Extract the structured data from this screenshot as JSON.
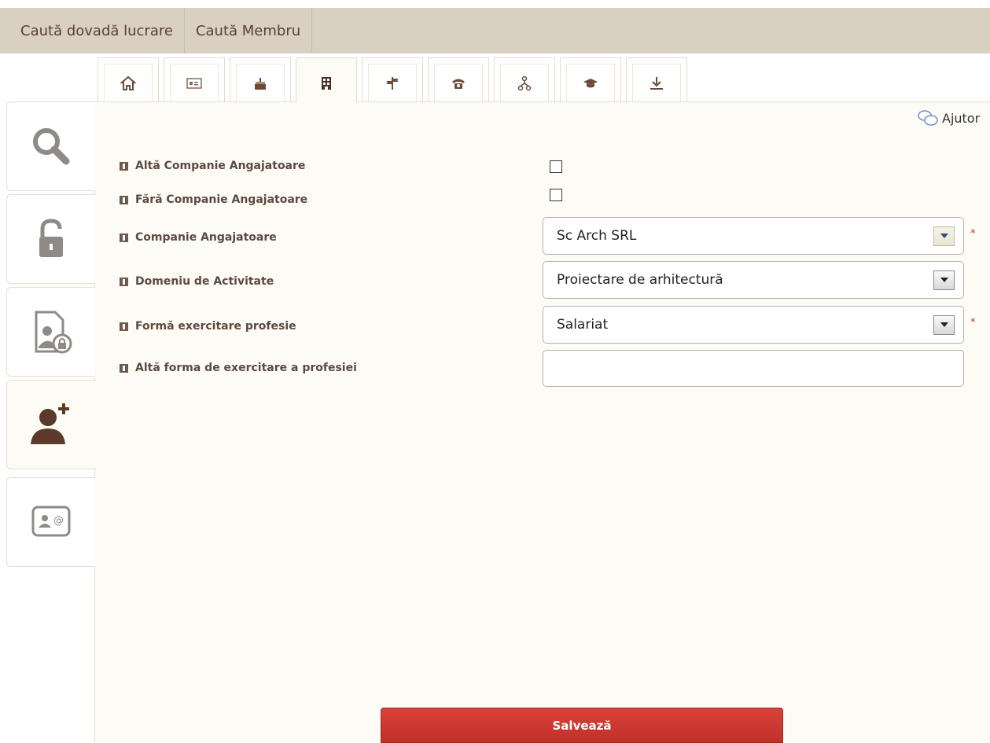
{
  "topnav": {
    "items": [
      {
        "label": "Caută dovadă lucrare"
      },
      {
        "label": "Caută Membru"
      }
    ]
  },
  "icon_tabs": [
    {
      "icon": "home-icon"
    },
    {
      "icon": "id-card-icon"
    },
    {
      "icon": "birthday-cake-icon"
    },
    {
      "icon": "building-icon",
      "active": true
    },
    {
      "icon": "signpost-icon"
    },
    {
      "icon": "phone-icon"
    },
    {
      "icon": "hierarchy-icon"
    },
    {
      "icon": "graduation-cap-icon"
    },
    {
      "icon": "download-icon"
    }
  ],
  "sidebar": [
    {
      "icon": "search-icon"
    },
    {
      "icon": "lock-icon"
    },
    {
      "icon": "secure-document-icon"
    },
    {
      "icon": "add-user-icon",
      "active": true
    },
    {
      "icon": "contact-card-icon"
    }
  ],
  "help": {
    "label": "Ajutor"
  },
  "form": {
    "alta_companie_label": "Altă Companie Angajatoare",
    "fara_companie_label": "Fără Companie Angajatoare",
    "companie_label": "Companie Angajatoare",
    "companie_value": "Sc Arch SRL",
    "domeniu_label": "Domeniu de Activitate",
    "domeniu_value": "Proiectare de arhitectură",
    "forma_label": "Formă exercitare profesie",
    "forma_value": "Salariat",
    "alta_forma_label": "Altă forma de exercitare a profesiei",
    "alta_forma_value": "",
    "required_mark": "*"
  },
  "save_button": {
    "label": "Salvează"
  },
  "colors": {
    "topnav_bg": "#d9d0c1",
    "panel_bg": "#fdfbf5",
    "icon_brown": "#5b3a29",
    "icon_gray": "#8d8a87",
    "save_red": "#c8362f"
  }
}
